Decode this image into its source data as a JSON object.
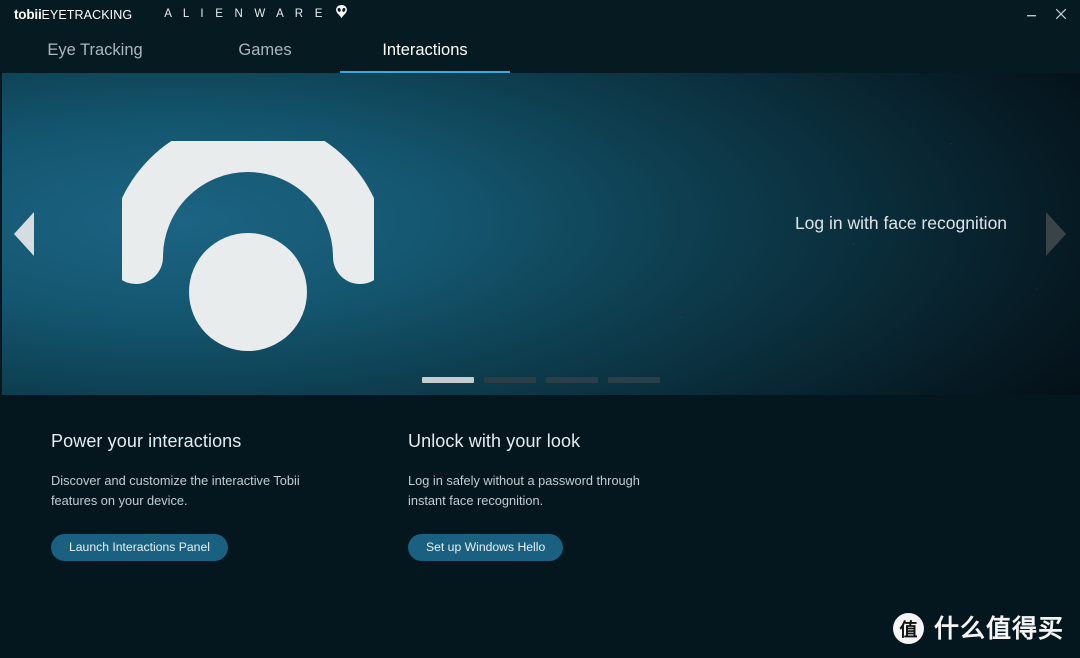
{
  "window": {
    "brand_primary_bold": "tobii",
    "brand_primary_light": "EYETRACKING",
    "brand_secondary": "A L I E N W A R E",
    "minimize_label": "—",
    "close_label": "✕",
    "alien_head_icon": "alienware-head-icon"
  },
  "tabs": [
    {
      "label": "Eye Tracking",
      "active": false
    },
    {
      "label": "Games",
      "active": false
    },
    {
      "label": "Interactions",
      "active": true
    }
  ],
  "hero": {
    "caption": "Log in with face recognition",
    "logo_icon": "tobii-eye-logo-icon",
    "prev_icon": "chevron-left-icon",
    "next_icon": "chevron-right-icon",
    "slides": [
      {
        "active": true
      },
      {
        "active": false
      },
      {
        "active": false
      },
      {
        "active": false
      }
    ],
    "active_slide": 1,
    "slide_count": 4
  },
  "cards": [
    {
      "title": "Power your interactions",
      "description": "Discover and customize the interactive Tobii features on your device.",
      "button_label": "Launch Interactions Panel"
    },
    {
      "title": "Unlock with your look",
      "description": "Log in safely without a password through instant face recognition.",
      "button_label": "Set up Windows Hello"
    }
  ],
  "watermark": {
    "badge_char": "值",
    "text": "什么值得买"
  },
  "colors": {
    "accent_tab_underline": "#3aa8dd",
    "button_fill": "#1a6080",
    "titlebar_bg": "#061a21",
    "content_bg": "#04161e",
    "hero_teal": "#14566f",
    "dot_active": "#c3cdd1",
    "dot_inactive": "#2b3f48"
  }
}
